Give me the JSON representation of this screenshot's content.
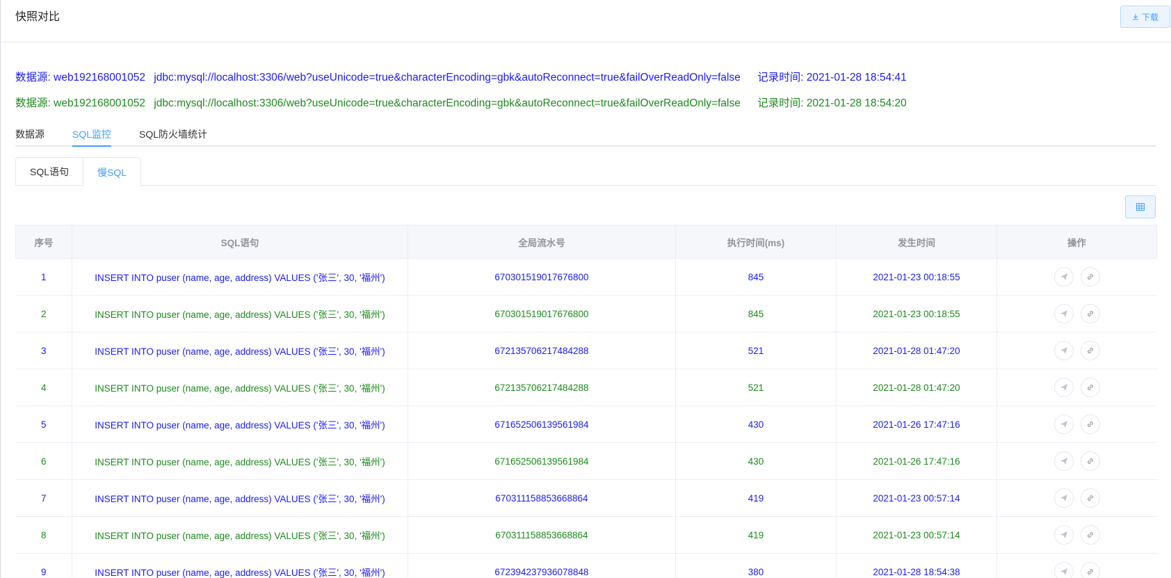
{
  "page_title": "快照对比",
  "download_label": "下载",
  "sources": [
    {
      "label": "数据源:",
      "name": "web192168001052",
      "url": "jdbc:mysql://localhost:3306/web?useUnicode=true&characterEncoding=gbk&autoReconnect=true&failOverReadOnly=false",
      "time_label": "记录时间:",
      "time": "2021-01-28 18:54:41",
      "color": "#1a1aff"
    },
    {
      "label": "数据源:",
      "name": "web192168001052",
      "url": "jdbc:mysql://localhost:3306/web?useUnicode=true&characterEncoding=gbk&autoReconnect=true&failOverReadOnly=false",
      "time_label": "记录时间:",
      "time": "2021-01-28 18:54:20",
      "color": "#1b8a1b"
    }
  ],
  "main_tabs": [
    {
      "label": "数据源"
    },
    {
      "label": "SQL监控"
    },
    {
      "label": "SQL防火墙统计"
    }
  ],
  "sub_tabs": [
    {
      "label": "SQL语句"
    },
    {
      "label": "慢SQL"
    }
  ],
  "table": {
    "columns": [
      "序号",
      "SQL语句",
      "全局流水号",
      "执行时间(ms)",
      "发生时间",
      "操作"
    ],
    "rows": [
      {
        "no": "1",
        "sql": "INSERT INTO puser (name, age, address) VALUES ('张三', 30, '福州')",
        "serial": "670301519017676800",
        "ms": "845",
        "time": "2021-01-23 00:18:55"
      },
      {
        "no": "2",
        "sql": "INSERT INTO puser (name, age, address) VALUES ('张三', 30, '福州')",
        "serial": "670301519017676800",
        "ms": "845",
        "time": "2021-01-23 00:18:55"
      },
      {
        "no": "3",
        "sql": "INSERT INTO puser (name, age, address) VALUES ('张三', 30, '福州')",
        "serial": "672135706217484288",
        "ms": "521",
        "time": "2021-01-28 01:47:20"
      },
      {
        "no": "4",
        "sql": "INSERT INTO puser (name, age, address) VALUES ('张三', 30, '福州')",
        "serial": "672135706217484288",
        "ms": "521",
        "time": "2021-01-28 01:47:20"
      },
      {
        "no": "5",
        "sql": "INSERT INTO puser (name, age, address) VALUES ('张三', 30, '福州')",
        "serial": "671652506139561984",
        "ms": "430",
        "time": "2021-01-26 17:47:16"
      },
      {
        "no": "6",
        "sql": "INSERT INTO puser (name, age, address) VALUES ('张三', 30, '福州')",
        "serial": "671652506139561984",
        "ms": "430",
        "time": "2021-01-26 17:47:16"
      },
      {
        "no": "7",
        "sql": "INSERT INTO puser (name, age, address) VALUES ('张三', 30, '福州')",
        "serial": "670311158853668864",
        "ms": "419",
        "time": "2021-01-23 00:57:14"
      },
      {
        "no": "8",
        "sql": "INSERT INTO puser (name, age, address) VALUES ('张三', 30, '福州')",
        "serial": "670311158853668864",
        "ms": "419",
        "time": "2021-01-23 00:57:14"
      },
      {
        "no": "9",
        "sql": "INSERT INTO puser (name, age, address) VALUES ('张三', 30, '福州')",
        "serial": "672394237936078848",
        "ms": "380",
        "time": "2021-01-28 18:54:38"
      }
    ]
  }
}
